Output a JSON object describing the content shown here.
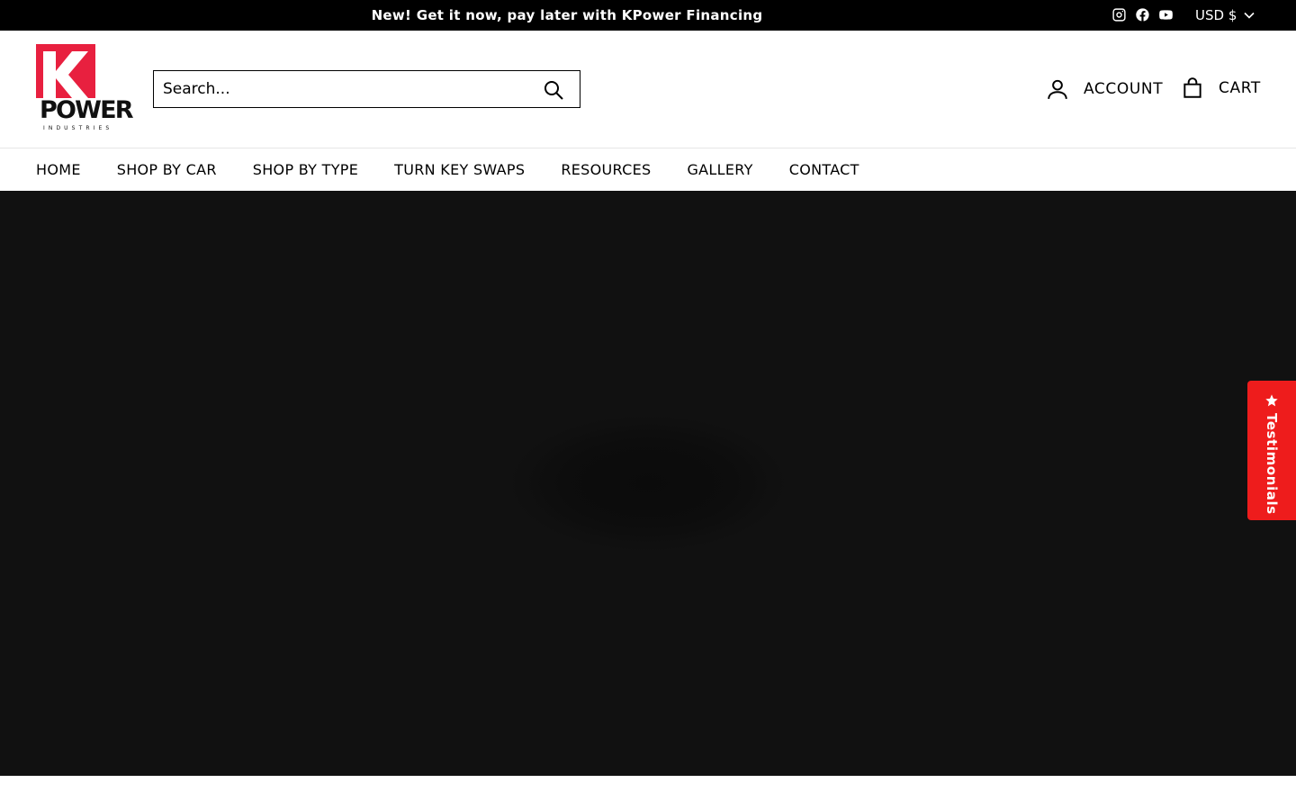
{
  "announcement": {
    "text": "New! Get it now, pay later with KPower Financing"
  },
  "social": [
    "instagram-icon",
    "facebook-icon",
    "youtube-icon"
  ],
  "currency": {
    "label": "USD $"
  },
  "logo": {
    "word": "POWER",
    "sub": "INDUSTRIES"
  },
  "search": {
    "placeholder": "Search..."
  },
  "header": {
    "account_label": "ACCOUNT",
    "cart_label": "CART"
  },
  "nav": {
    "items": [
      "HOME",
      "SHOP BY CAR",
      "SHOP BY TYPE",
      "TURN KEY SWAPS",
      "RESOURCES",
      "GALLERY",
      "CONTACT"
    ]
  },
  "testimonials": {
    "label": "Testimonials"
  },
  "colors": {
    "brand_red": "#e8203f",
    "tab_red": "#ee1c1c",
    "hero_bg": "#111111"
  }
}
